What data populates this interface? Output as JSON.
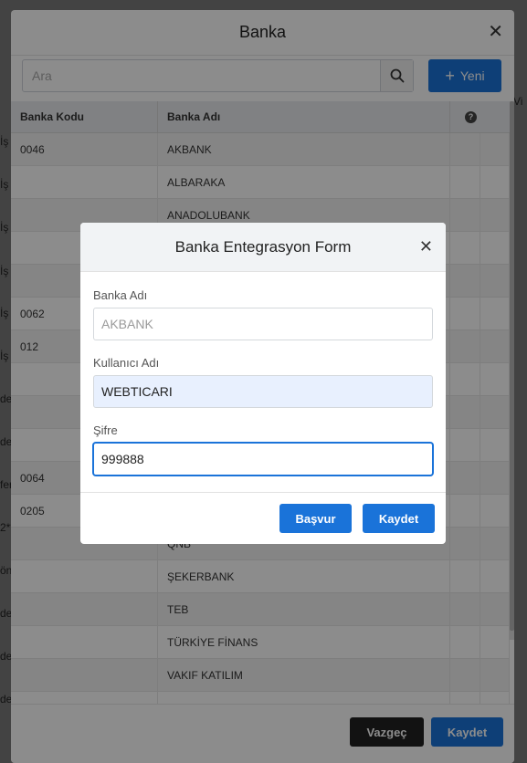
{
  "outer": {
    "title": "Banka",
    "search_placeholder": "Ara",
    "new_label": "Yeni",
    "columns": [
      "Banka Kodu",
      "Banka Adı"
    ],
    "rows": [
      {
        "code": "0046",
        "name": "AKBANK"
      },
      {
        "code": "",
        "name": "ALBARAKA"
      },
      {
        "code": "",
        "name": "ANADOLUBANK"
      },
      {
        "code": "",
        "name": ""
      },
      {
        "code": "",
        "name": ""
      },
      {
        "code": "0062",
        "name": ""
      },
      {
        "code": "012",
        "name": ""
      },
      {
        "code": "",
        "name": ""
      },
      {
        "code": "",
        "name": ""
      },
      {
        "code": "",
        "name": ""
      },
      {
        "code": "0064",
        "name": ""
      },
      {
        "code": "0205",
        "name": ""
      },
      {
        "code": "",
        "name": "QNB"
      },
      {
        "code": "",
        "name": "ŞEKERBANK"
      },
      {
        "code": "",
        "name": "TEB"
      },
      {
        "code": "",
        "name": "TÜRKİYE FİNANS"
      },
      {
        "code": "",
        "name": "VAKIF KATILIM"
      },
      {
        "code": "",
        "name": ""
      }
    ],
    "cancel_label": "Vazgeç",
    "save_label": "Kaydet"
  },
  "background": {
    "left_fragments": [
      "İş",
      "İş",
      "İş",
      "İş",
      "İş",
      "İş",
      "den",
      "den",
      "fer",
      "2**",
      "önd",
      "den",
      "den",
      "den"
    ],
    "right_fragment": "Vi"
  },
  "inner": {
    "title": "Banka Entegrasyon Form",
    "bank_name_label": "Banka Adı",
    "bank_name_value": "AKBANK",
    "username_label": "Kullanıcı Adı",
    "username_value": "WEBTICARI",
    "password_label": "Şifre",
    "password_value": "999888",
    "apply_label": "Başvur",
    "save_label": "Kaydet"
  }
}
